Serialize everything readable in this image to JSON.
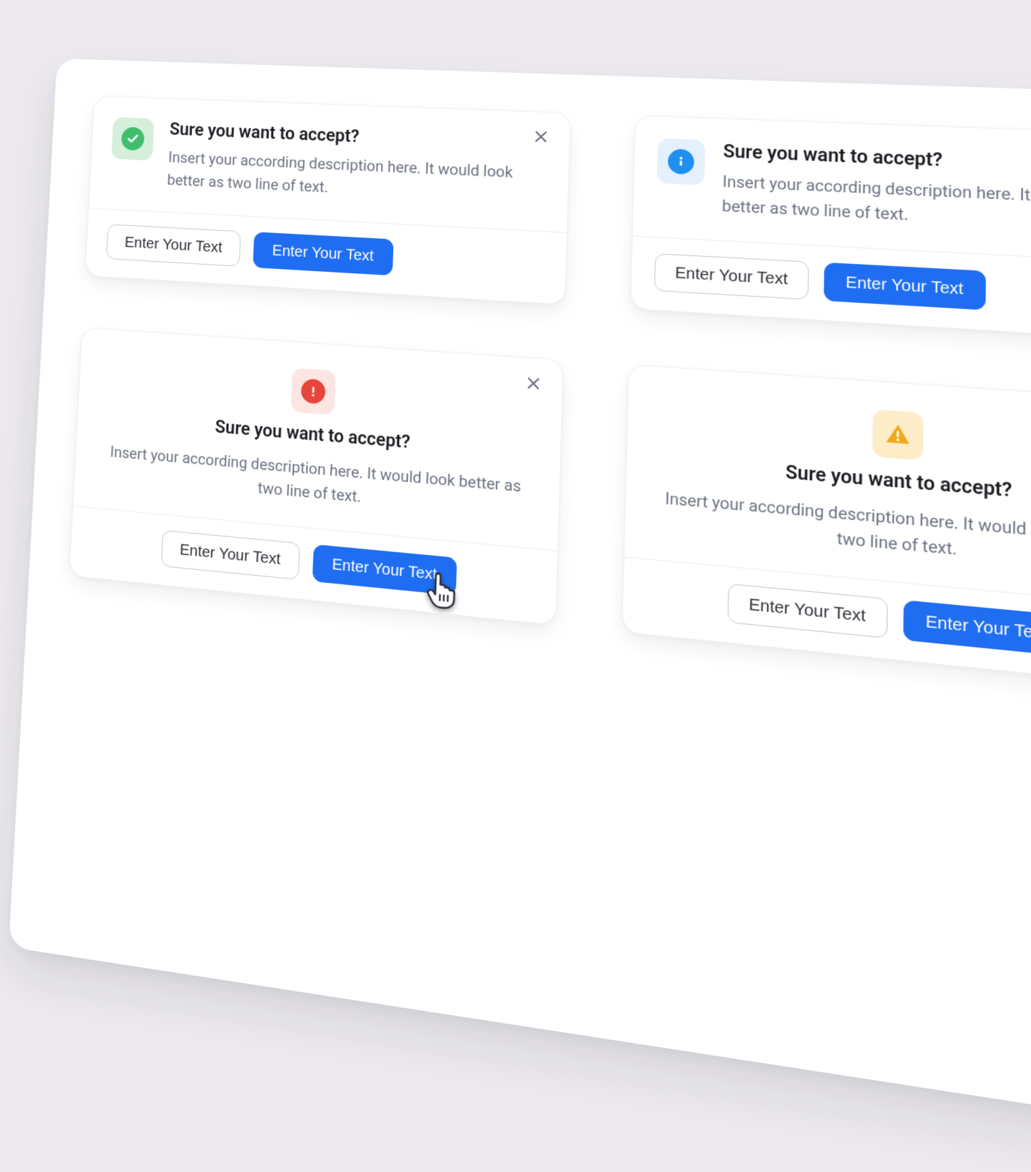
{
  "cards": [
    {
      "variant": "success",
      "layout": "horizontal",
      "icon": "check-icon",
      "title": "Sure you want to accept?",
      "description": "Insert your according description here. It would look better as two line of text.",
      "secondary_label": "Enter Your Text",
      "primary_label": "Enter Your Text"
    },
    {
      "variant": "info",
      "layout": "horizontal",
      "icon": "info-icon",
      "title": "Sure you want to accept?",
      "description": "Insert your according description here. It would look better as two line of text.",
      "secondary_label": "Enter Your Text",
      "primary_label": "Enter Your Text"
    },
    {
      "variant": "error",
      "layout": "vertical",
      "icon": "alert-circle-icon",
      "title": "Sure you want to accept?",
      "description": "Insert your according description here. It would look better as two line of text.",
      "secondary_label": "Enter Your Text",
      "primary_label": "Enter Your Text"
    },
    {
      "variant": "warning",
      "layout": "vertical",
      "icon": "alert-triangle-icon",
      "title": "Sure you want to accept?",
      "description": "Insert your according description here. It would look better as two line of text.",
      "secondary_label": "Enter Your Text",
      "primary_label": "Enter Your Text"
    }
  ],
  "colors": {
    "primary": "#1f6ef2",
    "success": "#3fbf6b",
    "info": "#1f8ff0",
    "error": "#e8443b",
    "warning": "#f0a81e",
    "text": "#1b1d22",
    "muted": "#6b7280"
  }
}
